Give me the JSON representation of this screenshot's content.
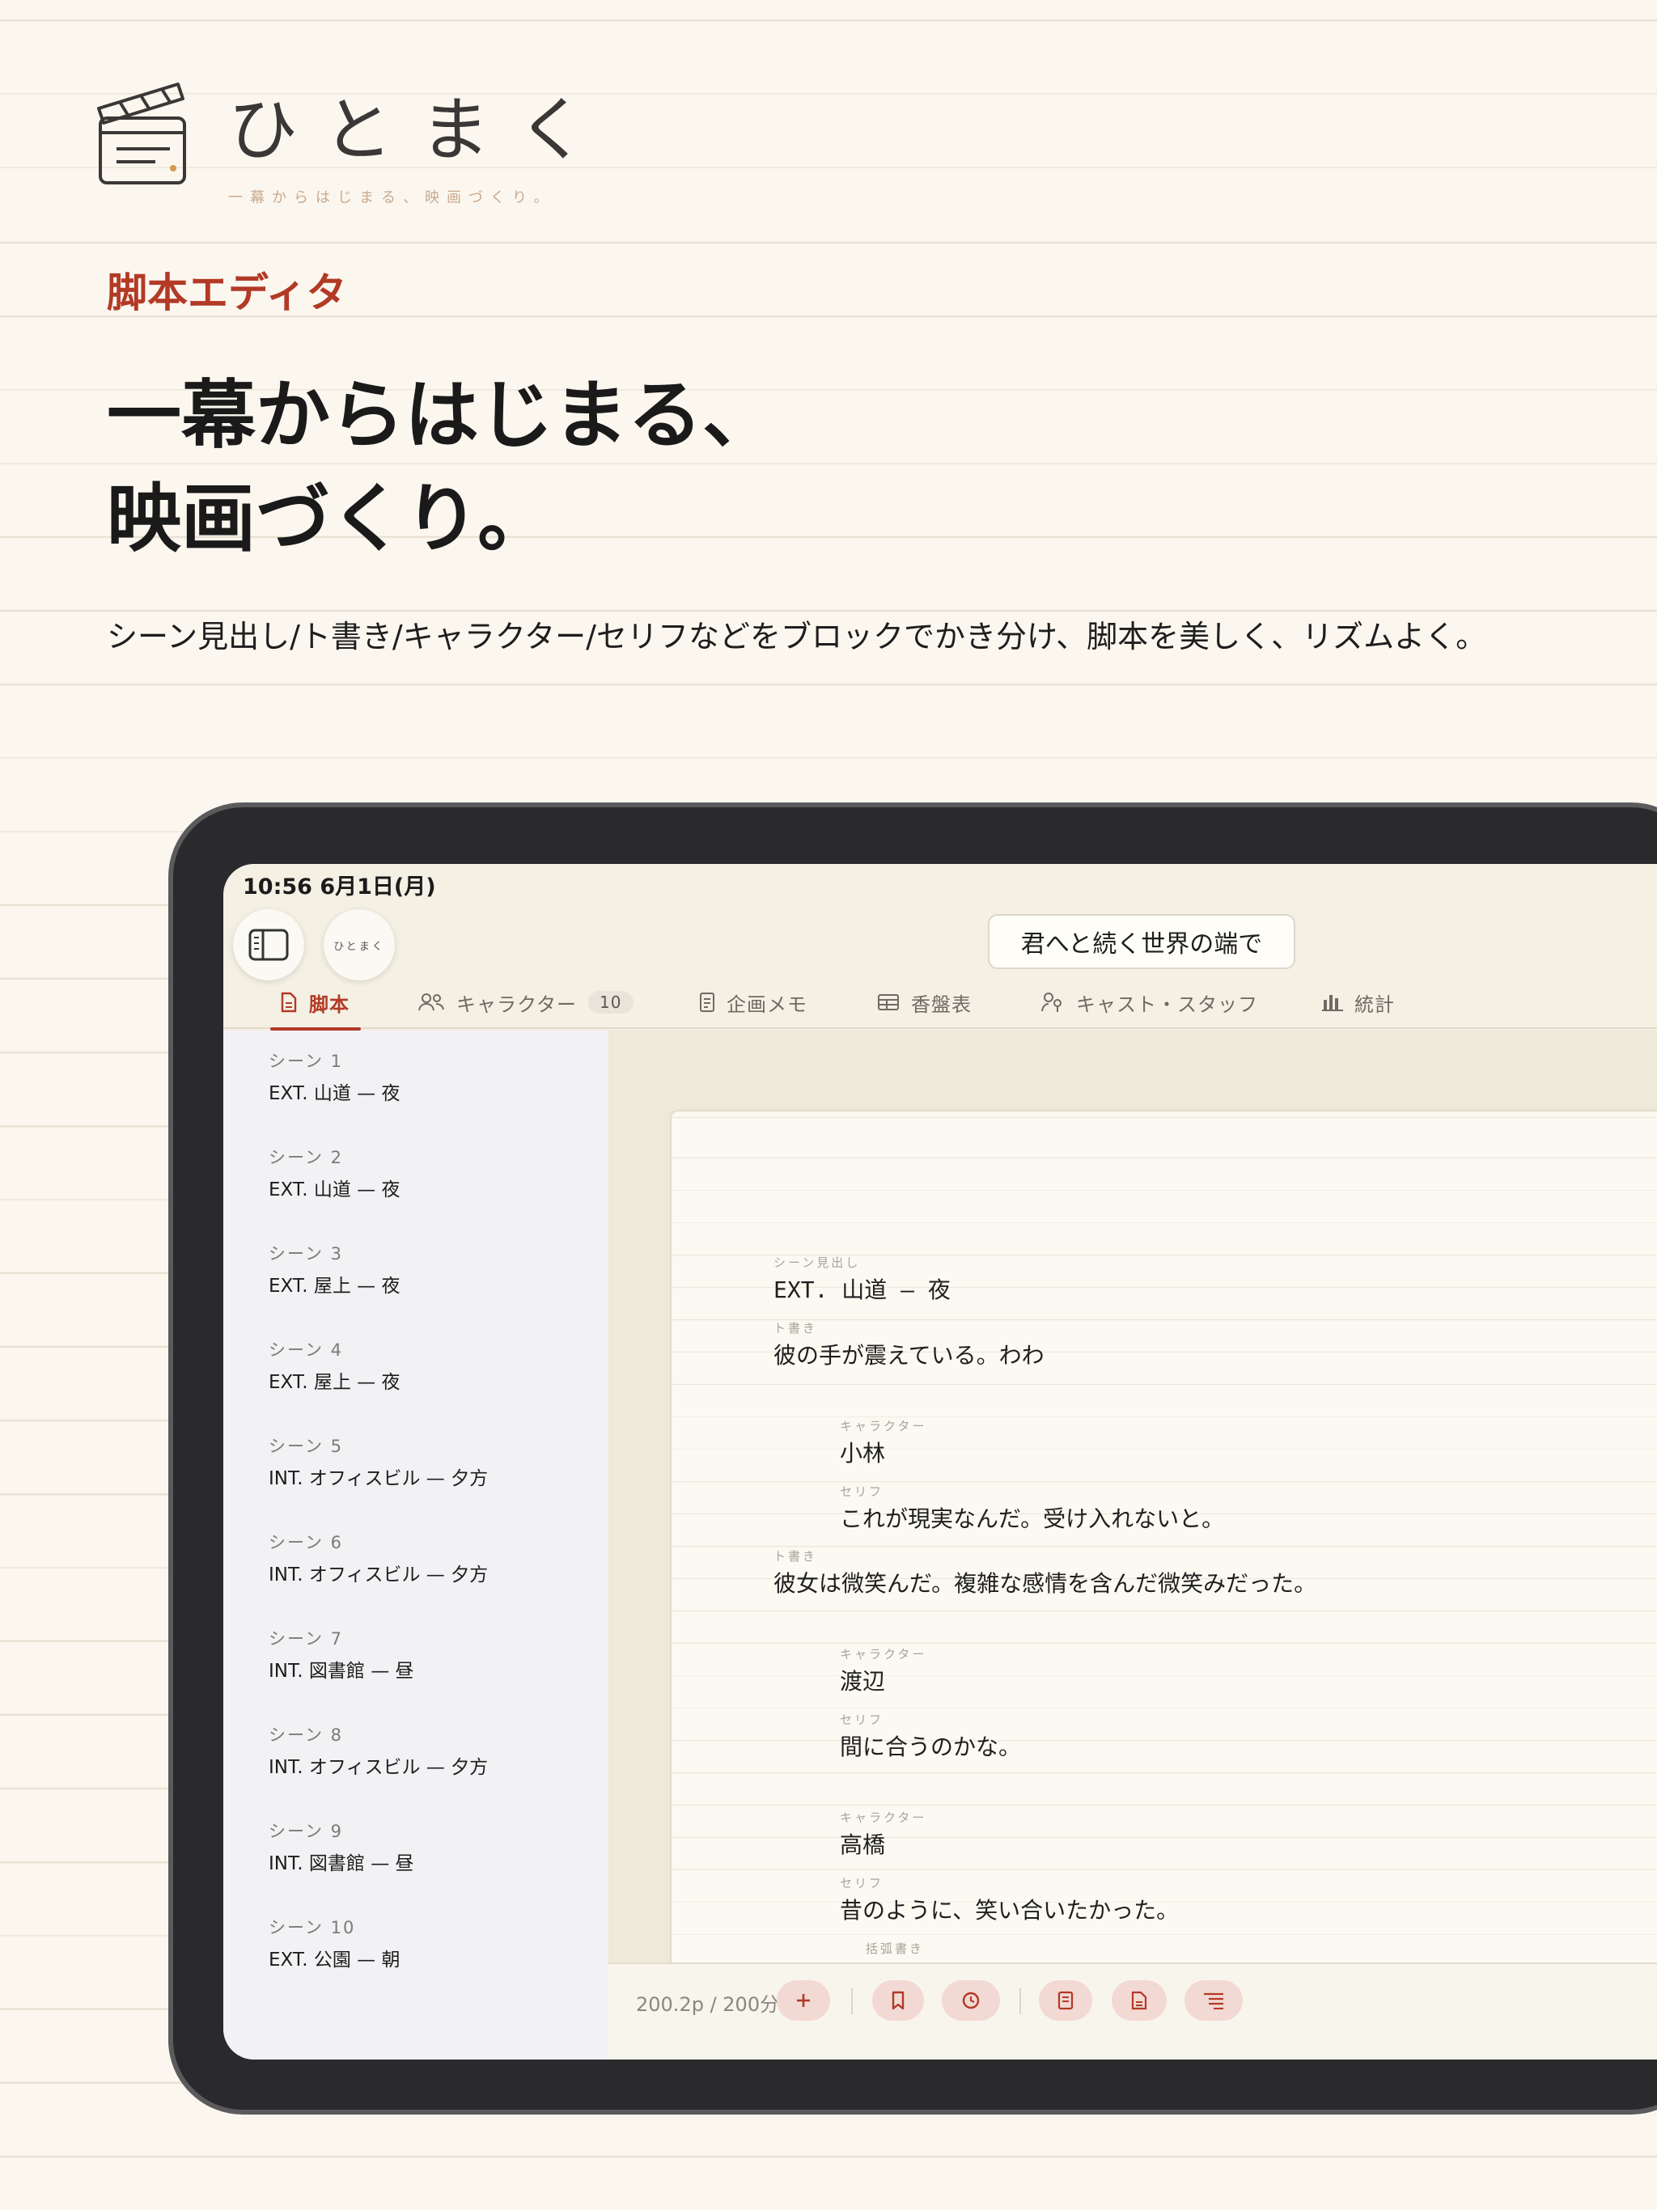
{
  "brand": {
    "name": "ひとまく",
    "tagline": "一幕からはじまる、映画づくり。"
  },
  "hero": {
    "section_label": "脚本エディタ",
    "headline_line1": "一幕からはじまる、",
    "headline_line2": "映画づくり。",
    "description": "シーン見出し/ト書き/キャラクター/セリフなどをブロックでかき分け、脚本を美しく、リズムよく。"
  },
  "app": {
    "status_time": "10:56   6月1日(月)",
    "mini_logo": "ひとまく",
    "project_title": "君へと続く世界の端で",
    "tabs": [
      {
        "label": "脚本",
        "icon": "document-icon",
        "active": true
      },
      {
        "label": "キャラクター",
        "icon": "people-icon",
        "badge": "10"
      },
      {
        "label": "企画メモ",
        "icon": "memo-icon"
      },
      {
        "label": "香盤表",
        "icon": "table-icon"
      },
      {
        "label": "キャスト・スタッフ",
        "icon": "person-key-icon"
      },
      {
        "label": "統計",
        "icon": "bar-chart-icon"
      }
    ],
    "scenes": [
      {
        "num": "シーン 1",
        "title": "EXT. 山道 — 夜"
      },
      {
        "num": "シーン 2",
        "title": "EXT. 山道 — 夜"
      },
      {
        "num": "シーン 3",
        "title": "EXT. 屋上 — 夜"
      },
      {
        "num": "シーン 4",
        "title": "EXT. 屋上 — 夜"
      },
      {
        "num": "シーン 5",
        "title": "INT. オフィスビル — 夕方"
      },
      {
        "num": "シーン 6",
        "title": "INT. オフィスビル — 夕方"
      },
      {
        "num": "シーン 7",
        "title": "INT. 図書館 — 昼"
      },
      {
        "num": "シーン 8",
        "title": "INT. オフィスビル — 夕方"
      },
      {
        "num": "シーン 9",
        "title": "INT. 図書館 — 昼"
      },
      {
        "num": "シーン 10",
        "title": "EXT. 公園 — 朝"
      }
    ],
    "script": [
      {
        "label": "シーン見出し",
        "text": "EXT. 山道 — 夜"
      },
      {
        "label": "ト書き",
        "text": "彼の手が震えている。わわ"
      },
      {
        "label": "キャラクター",
        "text": "小林"
      },
      {
        "label": "セリフ",
        "text": "これが現実なんだ。受け入れないと。"
      },
      {
        "label": "ト書き",
        "text": "彼女は微笑んだ。複雑な感情を含んだ微笑みだった。"
      },
      {
        "label": "キャラクター",
        "text": "渡辺"
      },
      {
        "label": "セリフ",
        "text": "間に合うのかな。"
      },
      {
        "label": "キャラクター",
        "text": "高橋"
      },
      {
        "label": "セリフ",
        "text": "昔のように、笑い合いたかった。"
      },
      {
        "label": "括弧書き",
        "text": ""
      }
    ],
    "page_count": "200.2p / 200分",
    "toolbar_icons": [
      "plus-icon",
      "bookmark-icon",
      "history-icon",
      "notes-icon",
      "export-icon",
      "outline-icon"
    ],
    "accent": "#b23a26"
  }
}
